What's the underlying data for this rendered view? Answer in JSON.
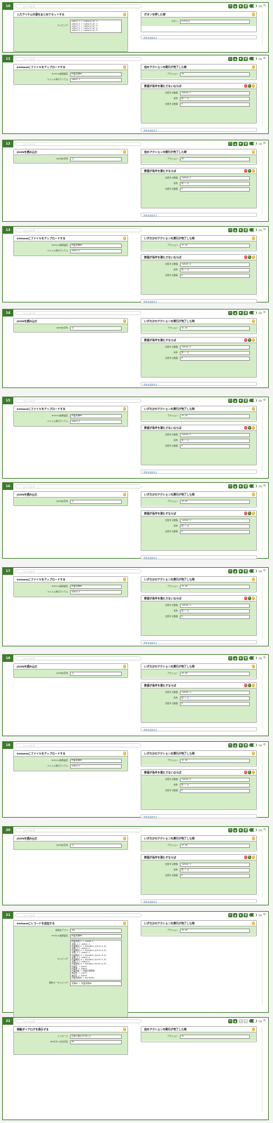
{
  "toolbar": {
    "memo_placeholder": "コメントを入力",
    "status_label": "有効",
    "icons": [
      "copy-icon",
      "move-up-icon",
      "move-down-icon",
      "delete-icon"
    ]
  },
  "blocks": [
    {
      "no": "10",
      "action": {
        "title": "入力アイテムの値をまとめてセットする",
        "rows": [
          {
            "label": "マッピング",
            "value": "added_1 = numberList_1\nadded_2 = numberList_2\nadded_3 = numberList_3\nadded_4 = numberList_4\nadded_5 = numberList_5"
          }
        ]
      },
      "trigger": {
        "title": "ボタンを押した時",
        "rows": [
          {
            "label": "ボタン",
            "value": "button1"
          }
        ]
      },
      "conditions": [],
      "add_condition_label": "条件を追加する"
    },
    {
      "no": "11",
      "action": {
        "title": "kintoneにファイルをアップロードする",
        "rows": [
          {
            "label": "kintone連携設定",
            "value": "作業手順DB"
          },
          {
            "label": "ファイル添付アイテム",
            "value": "added_1"
          }
        ]
      },
      "trigger": {
        "title": "他のアクションの実行が完了した時",
        "rows": [
          {
            "label": "アクション",
            "value": "10"
          }
        ]
      },
      "conditions": [
        {
          "title": "数値が条件を満たさないならば",
          "rows": [
            {
              "label": "比較する数値",
              "value": "=added_1"
            },
            {
              "label": "条件",
              "value": "値 = 以"
            },
            {
              "label": "比較する数値",
              "value": "0"
            }
          ]
        }
      ],
      "add_condition_label": "条件を追加する"
    },
    {
      "no": "12",
      "action": {
        "title": "JSONを読み込む",
        "rows": [
          {
            "label": "JSON文字列",
            "value": "{}"
          }
        ]
      },
      "trigger": {
        "title": "他のアクションの実行が完了した時",
        "rows": [
          {
            "label": "アクション",
            "value": "11"
          }
        ]
      },
      "conditions": [
        {
          "title": "数値が条件を満たすならば",
          "rows": [
            {
              "label": "比較する数値",
              "value": "=added_1"
            },
            {
              "label": "条件",
              "value": "値 > 以"
            },
            {
              "label": "比較する数値",
              "value": "0"
            }
          ]
        }
      ],
      "add_condition_label": "条件を追加する"
    },
    {
      "no": "13",
      "action": {
        "title": "kintoneにファイルをアップロードする",
        "rows": [
          {
            "label": "kintone連携設定",
            "value": "作業手順DB"
          },
          {
            "label": "ファイル添付アイテム",
            "value": "added_2"
          }
        ]
      },
      "trigger": {
        "title": "いずれかのアクションの実行が完了した時",
        "rows": [
          {
            "label": "アクション",
            "value": "11,12"
          }
        ]
      },
      "conditions": [
        {
          "title": "数値が条件を満たさないならば",
          "rows": [
            {
              "label": "比較する数値",
              "value": "=added_2"
            },
            {
              "label": "条件",
              "value": "値 = 以"
            },
            {
              "label": "比較する数値",
              "value": "0"
            }
          ]
        }
      ],
      "add_condition_label": "条件を追加する"
    },
    {
      "no": "14",
      "action": {
        "title": "JSONを読み込む",
        "rows": [
          {
            "label": "JSON文字列",
            "value": "{}"
          }
        ]
      },
      "trigger": {
        "title": "いずれかのアクションの実行が完了した時",
        "rows": [
          {
            "label": "アクション",
            "value": "11,12"
          }
        ]
      },
      "conditions": [
        {
          "title": "数値が条件を満たすならば",
          "rows": [
            {
              "label": "比較する数値",
              "value": "=added_2"
            },
            {
              "label": "条件",
              "value": "値 > 以"
            },
            {
              "label": "比較する数値",
              "value": "0"
            }
          ]
        }
      ],
      "add_condition_label": "条件を追加する"
    },
    {
      "no": "15",
      "action": {
        "title": "kintoneにファイルをアップロードする",
        "rows": [
          {
            "label": "kintone連携設定",
            "value": "作業手順DB"
          },
          {
            "label": "ファイル添付アイテム",
            "value": "added_3"
          }
        ]
      },
      "trigger": {
        "title": "いずれかのアクションの実行が完了した時",
        "rows": [
          {
            "label": "アクション",
            "value": "13,14"
          }
        ]
      },
      "conditions": [
        {
          "title": "数値が条件を満たさないならば",
          "rows": [
            {
              "label": "比較する数値",
              "value": "=added_3"
            },
            {
              "label": "条件",
              "value": "値 = 以"
            },
            {
              "label": "比較する数値",
              "value": "0"
            }
          ]
        }
      ],
      "add_condition_label": "条件を追加する"
    },
    {
      "no": "16",
      "action": {
        "title": "JSONを読み込む",
        "rows": [
          {
            "label": "JSON文字列",
            "value": "{}"
          }
        ]
      },
      "trigger": {
        "title": "いずれかのアクションの実行が完了した時",
        "rows": [
          {
            "label": "アクション",
            "value": "13,14"
          }
        ]
      },
      "conditions": [
        {
          "title": "数値が条件を満たすならば",
          "rows": [
            {
              "label": "比較する数値",
              "value": "=added_3"
            },
            {
              "label": "条件",
              "value": "値 > 以"
            },
            {
              "label": "比較する数値",
              "value": "0"
            }
          ]
        }
      ],
      "add_condition_label": "条件を追加する"
    },
    {
      "no": "17",
      "action": {
        "title": "kintoneにファイルをアップロードする",
        "rows": [
          {
            "label": "kintone連携設定",
            "value": "作業手順DB"
          },
          {
            "label": "ファイル添付アイテム",
            "value": "added_4"
          }
        ]
      },
      "trigger": {
        "title": "いずれかのアクションの実行が完了した時",
        "rows": [
          {
            "label": "アクション",
            "value": "15,16"
          }
        ]
      },
      "conditions": [
        {
          "title": "数値が条件を満たさないならば",
          "rows": [
            {
              "label": "比較する数値",
              "value": "=added_4"
            },
            {
              "label": "条件",
              "value": "値 = 以"
            },
            {
              "label": "比較する数値",
              "value": "0"
            }
          ]
        }
      ],
      "add_condition_label": "条件を追加する"
    },
    {
      "no": "18",
      "action": {
        "title": "JSONを読み込む",
        "rows": [
          {
            "label": "JSON文字列",
            "value": "{}"
          }
        ]
      },
      "trigger": {
        "title": "いずれかのアクションの実行が完了した時",
        "rows": [
          {
            "label": "アクション",
            "value": "15,16"
          }
        ]
      },
      "conditions": [
        {
          "title": "数値が条件を満たすならば",
          "rows": [
            {
              "label": "比較する数値",
              "value": "=added_4"
            },
            {
              "label": "条件",
              "value": "値 > 以"
            },
            {
              "label": "比較する数値",
              "value": "0"
            }
          ]
        }
      ],
      "add_condition_label": "条件を追加する"
    },
    {
      "no": "19",
      "action": {
        "title": "kintoneにファイルをアップロードする",
        "rows": [
          {
            "label": "kintone連携設定",
            "value": "作業手順DB"
          },
          {
            "label": "ファイル添付アイテム",
            "value": "added_5"
          }
        ]
      },
      "trigger": {
        "title": "いずれかのアクションの実行が完了した時",
        "rows": [
          {
            "label": "アクション",
            "value": "17,18"
          }
        ]
      },
      "conditions": [
        {
          "title": "数値が条件を満たさないならば",
          "rows": [
            {
              "label": "比較する数値",
              "value": "=added_5"
            },
            {
              "label": "条件",
              "value": "値 = 以"
            },
            {
              "label": "比較する数値",
              "value": "0"
            }
          ]
        }
      ],
      "add_condition_label": "条件を追加する"
    },
    {
      "no": "20",
      "action": {
        "title": "JSONを読み込む",
        "rows": [
          {
            "label": "JSON文字列",
            "value": "{}"
          }
        ]
      },
      "trigger": {
        "title": "いずれかのアクションの実行が完了した時",
        "rows": [
          {
            "label": "アクション",
            "value": "17,18"
          }
        ]
      },
      "conditions": [
        {
          "title": "数値が条件を満たすならば",
          "rows": [
            {
              "label": "比較する数値",
              "value": "=added_5"
            },
            {
              "label": "条件",
              "value": "値 > 以"
            },
            {
              "label": "比較する数値",
              "value": "0"
            }
          ]
        }
      ],
      "add_condition_label": "条件を追加する"
    },
    {
      "no": "21",
      "action": {
        "title": "kintoneにレコードを追加する",
        "rows": [
          {
            "label": "追加先アプリ",
            "value": "161"
          },
          {
            "label": "kintone連携設定",
            "value": "作業手順DB"
          },
          {
            "label": "マッピング",
            "value": "作業手順_1 = added_1\n手順_1 = added_1\n作業時間_1 = #{added_1}%=1(1,0)\n手順_2 = added_2\n作業時間_2 = #{added_2}%=1(1,0)\n手順_3 = added_3\n作業時間_3 = #{added_3}%=1(1,0)\n手順_4 = added_4\n作業時間_4 = #{added_4}%=1(1,0)\n手順_5 = added_5\n作業時間_5 = #{added_5}%=1(1,0)\n作業日 = date1\n作業者 = name1\n作業内容 = 作業手順登録\n確認者 = user1\n確認日 = date2\n作業手順ID = #{item1}"
          },
          {
            "label": "更新キーマッピング",
            "value": "手順ID = 作業手順ID　"
          }
        ]
      },
      "trigger": {
        "title": "いずれかのアクションの実行が完了した時",
        "rows": [
          {
            "label": "アクション",
            "value": "19,20"
          }
        ]
      },
      "conditions": [],
      "add_condition_label": ""
    },
    {
      "no": "22",
      "action": {
        "title": "情報ダイアログを表示する",
        "rows": [
          {
            "label": "メッセージ",
            "value": "正常に送信されました"
          },
          {
            "label": "OKボタンの表示名",
            "value": "OK"
          }
        ]
      },
      "trigger": {
        "title": "他のアクションの実行が完了した時",
        "rows": [
          {
            "label": "アクション",
            "value": "21"
          }
        ]
      },
      "conditions": [],
      "add_condition_label": ""
    }
  ]
}
